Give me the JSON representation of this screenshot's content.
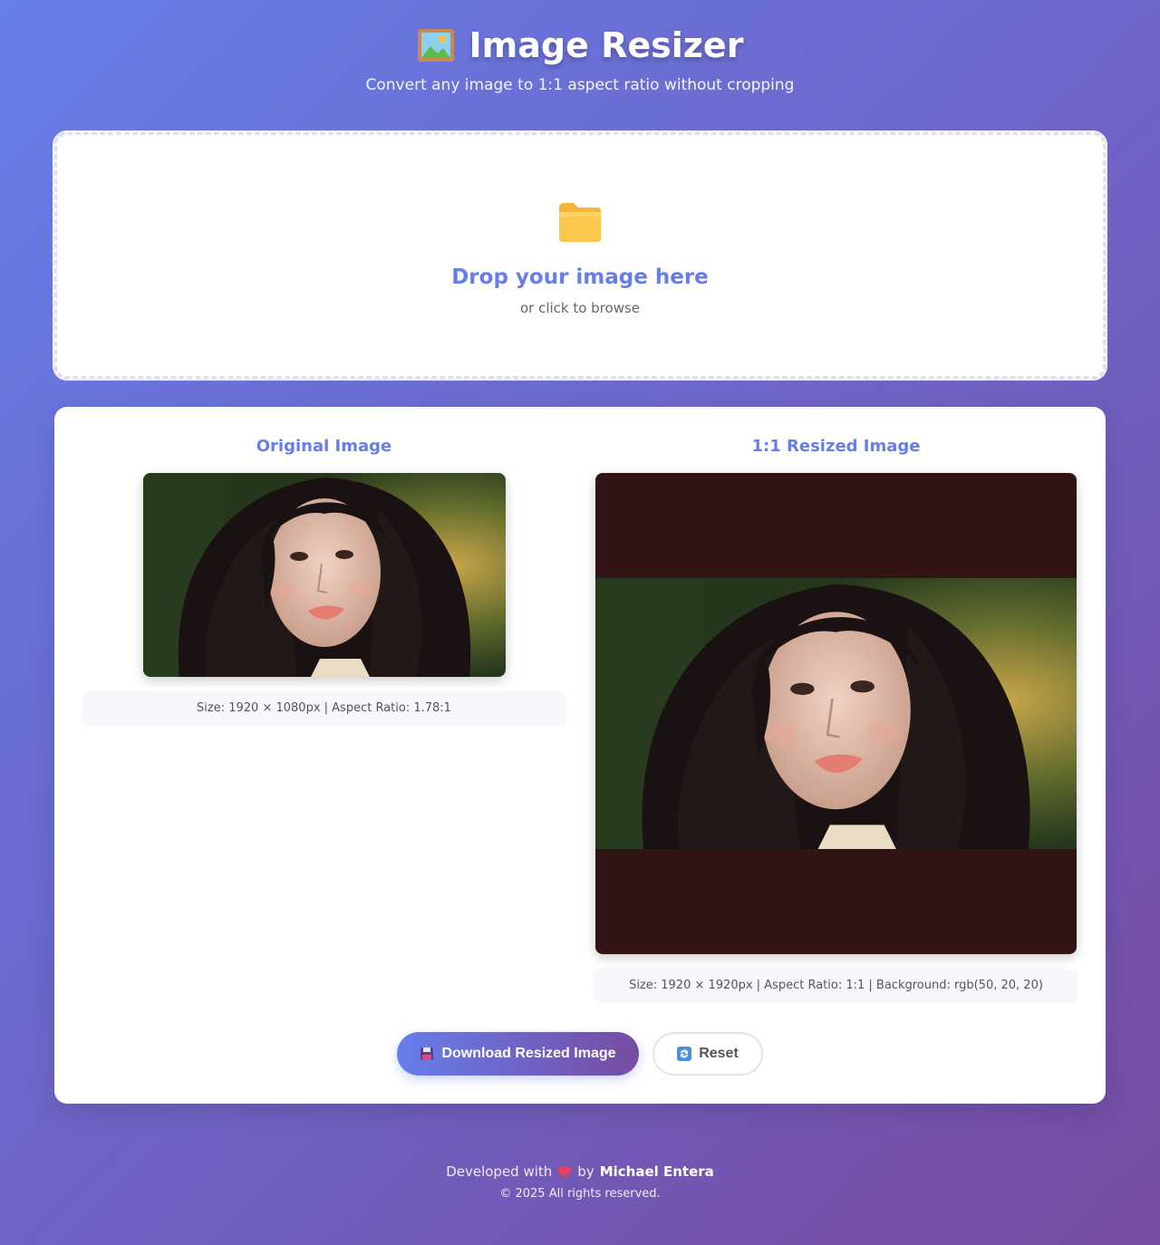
{
  "header": {
    "title": "Image Resizer",
    "subtitle": "Convert any image to 1:1 aspect ratio without cropping"
  },
  "dropzone": {
    "title": "Drop your image here",
    "subtitle": "or click to browse"
  },
  "original": {
    "title": "Original Image",
    "info": "Size: 1920 × 1080px | Aspect Ratio: 1.78:1"
  },
  "resized": {
    "title": "1:1 Resized Image",
    "info": "Size: 1920 × 1920px | Aspect Ratio: 1:1 | Background: rgb(50, 20, 20)",
    "background_color": "#321414"
  },
  "actions": {
    "download_label": "Download Resized Image",
    "reset_label": "Reset"
  },
  "footer": {
    "developed_with": "Developed with",
    "by": "by",
    "author": "Michael Entera",
    "copyright": "© 2025 All rights reserved."
  },
  "colors": {
    "accent": "#667eea",
    "accent_end": "#764ba2"
  }
}
